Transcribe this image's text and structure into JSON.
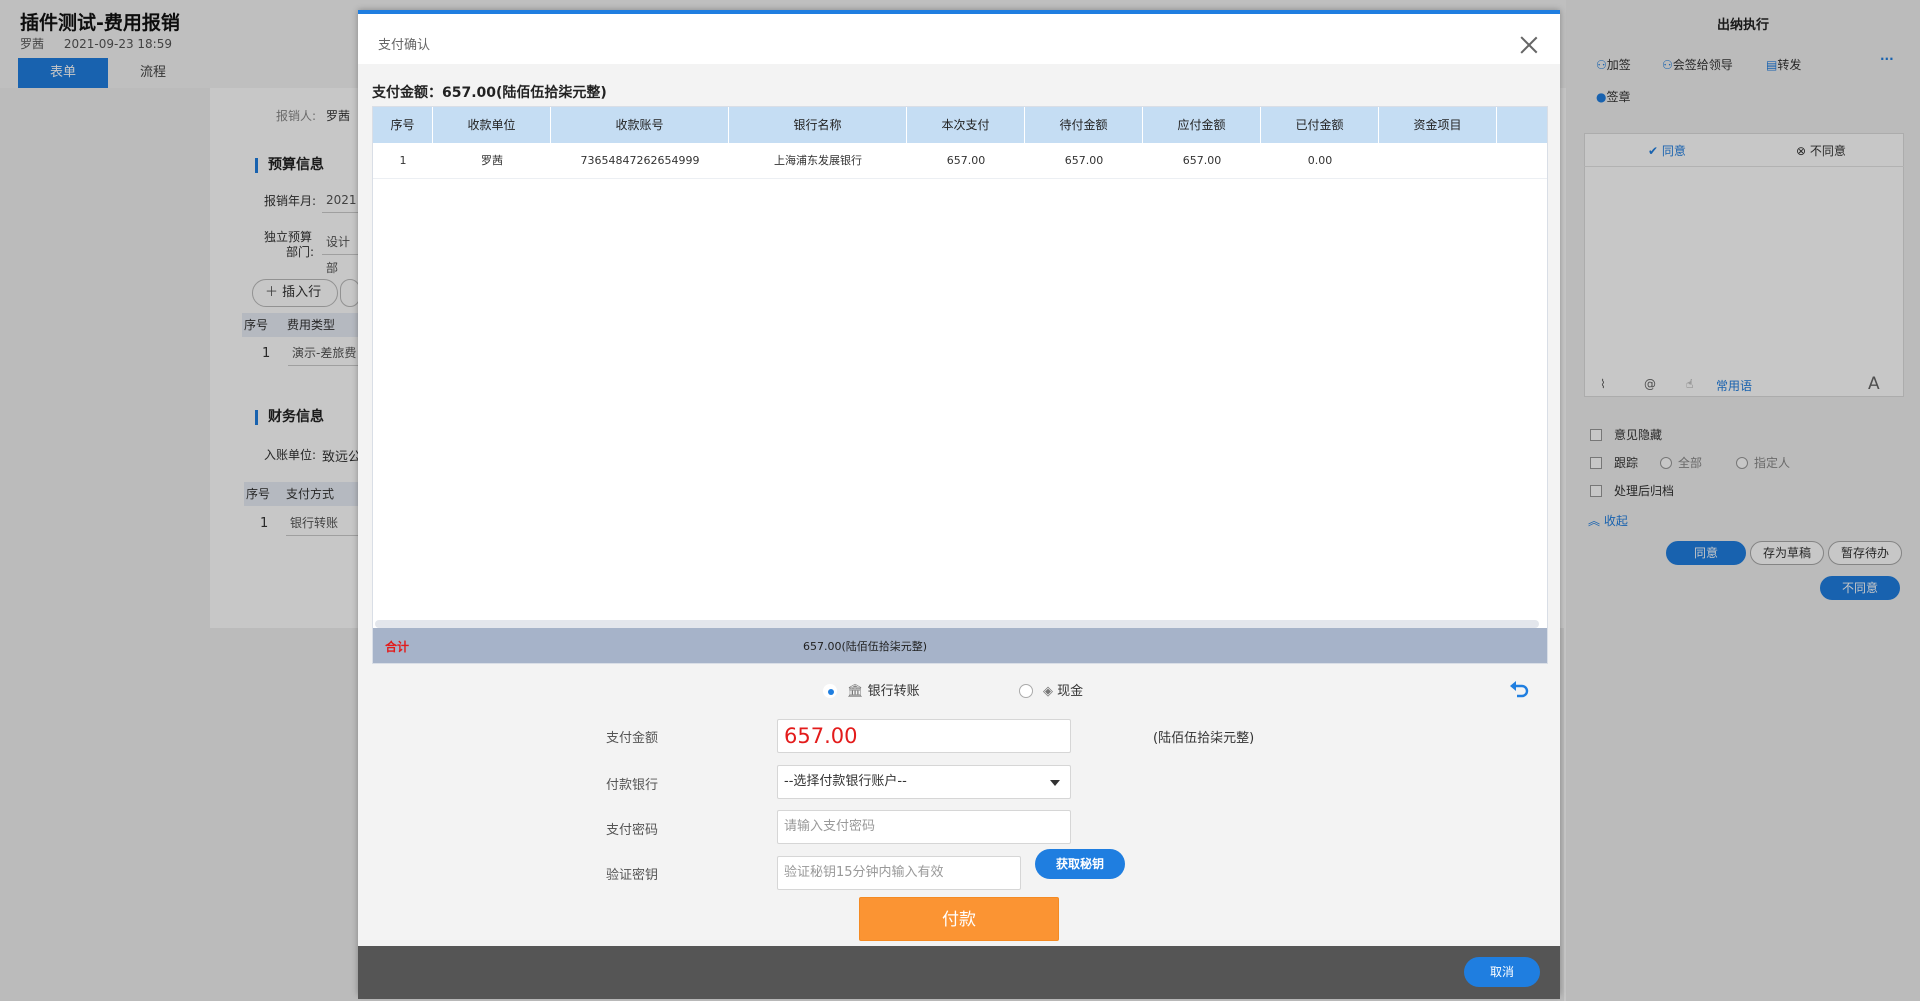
{
  "background": {
    "title": "插件测试-费用报销",
    "author": "罗茜",
    "datetime": "2021-09-23 18:59",
    "tabs": [
      "表单",
      "流程"
    ],
    "reporter_label": "报销人:",
    "reporter_value": "罗茜",
    "section_budget": "预算信息",
    "budget_year_label": "报销年月:",
    "budget_year_value": "2021",
    "budget_dept_label_1": "独立预算",
    "budget_dept_label_2": "部门:",
    "budget_dept_value": "设计部",
    "insert_row": "插入行",
    "grid1_headers": [
      "序号",
      "费用类型"
    ],
    "grid1_row": [
      "1",
      "演示-差旅费"
    ],
    "section_finance": "财务信息",
    "account_unit_label": "入账单位:",
    "account_unit_value": "致远公",
    "grid2_headers": [
      "序号",
      "支付方式"
    ],
    "grid2_row": [
      "1",
      "银行转账"
    ]
  },
  "right_panel": {
    "title": "出纳执行",
    "actions": [
      "加签",
      "会签给领导",
      "转发",
      "签章"
    ],
    "more": "···",
    "opinion_agree": "同意",
    "opinion_disagree": "不同意",
    "common_phrases": "常用语",
    "font_icon_text": "A",
    "hide_opinion": "意见隐藏",
    "track": "跟踪",
    "track_all": "全部",
    "track_specified": "指定人",
    "archive_after": "处理后归档",
    "collapse": "收起",
    "btn_agree": "同意",
    "btn_save_draft": "存为草稿",
    "btn_hold": "暂存待办",
    "btn_disagree": "不同意"
  },
  "modal": {
    "title": "支付确认",
    "amount_line": "支付金额：657.00(陆佰伍拾柒元整)",
    "headers": [
      "序号",
      "收款单位",
      "收款账号",
      "银行名称",
      "本次支付",
      "待付金额",
      "应付金额",
      "已付金额",
      "资金项目"
    ],
    "rows": [
      [
        "1",
        "罗茜",
        "73654847262654999",
        "上海浦东发展银行",
        "657.00",
        "657.00",
        "657.00",
        "0.00",
        ""
      ]
    ],
    "total_label": "合计",
    "total_value": "657.00(陆佰伍拾柒元整)",
    "pay_methods": [
      {
        "label": "银行转账",
        "selected": true
      },
      {
        "label": "现金",
        "selected": false
      }
    ],
    "form": {
      "amount_label": "支付金额",
      "amount_value": "657.00",
      "amount_words": "(陆佰伍拾柒元整)",
      "bank_label": "付款银行",
      "bank_value": "--选择付款银行账户--",
      "password_label": "支付密码",
      "password_placeholder": "请输入支付密码",
      "verify_label": "验证密钥",
      "verify_placeholder": "验证秘钥15分钟内输入有效",
      "get_key": "获取秘钥",
      "pay_button": "付款"
    },
    "cancel": "取消"
  },
  "colors": {
    "accent": "#1f7ee0",
    "pay_button": "#fb9433",
    "amount_red": "#e31b1b"
  }
}
